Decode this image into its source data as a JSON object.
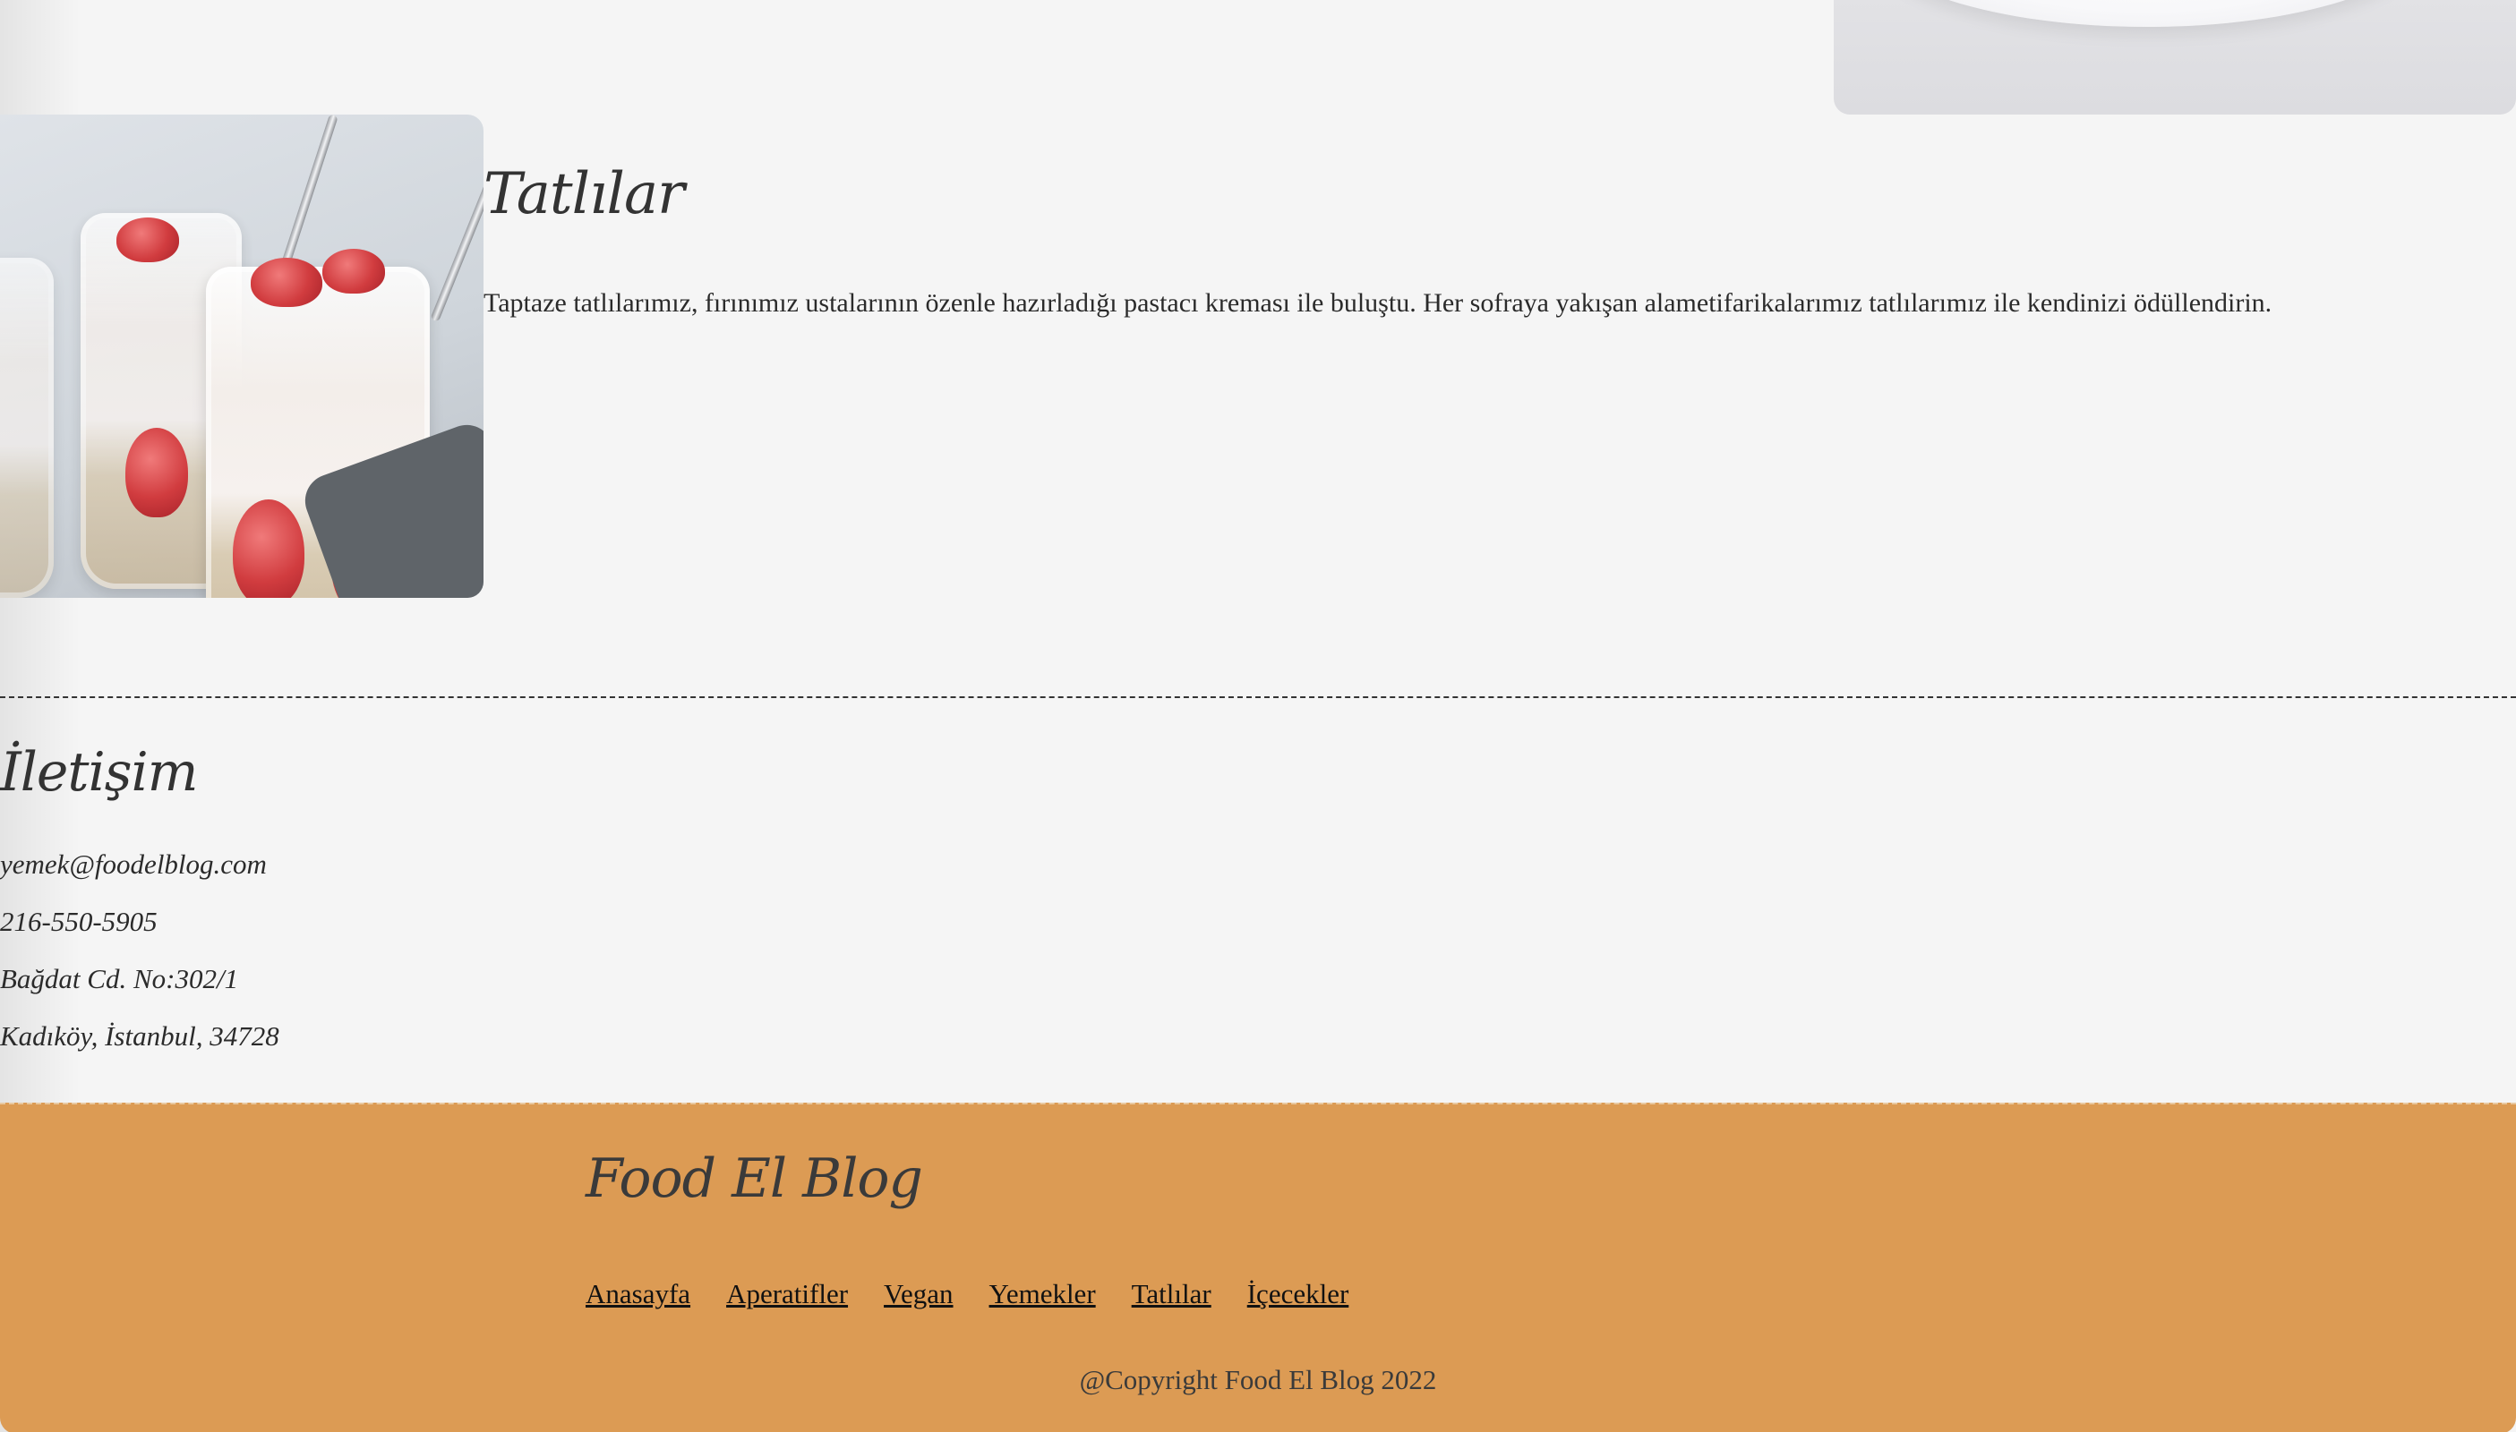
{
  "dessert": {
    "title": "Tatlılar",
    "description": "Taptaze tatlılarımız, fırınımız ustalarının özenle hazırladığı pastacı kreması ile buluştu. Her sofraya yakışan alametifarikalarımız tatlılarımız ile kendinizi ödüllendirin."
  },
  "contact": {
    "title": "İletişim",
    "email": "yemek@foodelblog.com",
    "phone": "216-550-5905",
    "address_line1": "Bağdat Cd. No:302/1",
    "address_line2": "Kadıköy, İstanbul, 34728"
  },
  "footer": {
    "title": "Food El Blog",
    "nav": [
      {
        "label": "Anasayfa"
      },
      {
        "label": "Aperatifler"
      },
      {
        "label": "Vegan"
      },
      {
        "label": "Yemekler"
      },
      {
        "label": "Tatlılar"
      },
      {
        "label": "İçecekler"
      }
    ],
    "copyright": "@Copyright Food El Blog 2022"
  },
  "colors": {
    "background": "#f5f5f5",
    "footer_bg": "#dc9b54",
    "text": "#2b2b2b"
  }
}
